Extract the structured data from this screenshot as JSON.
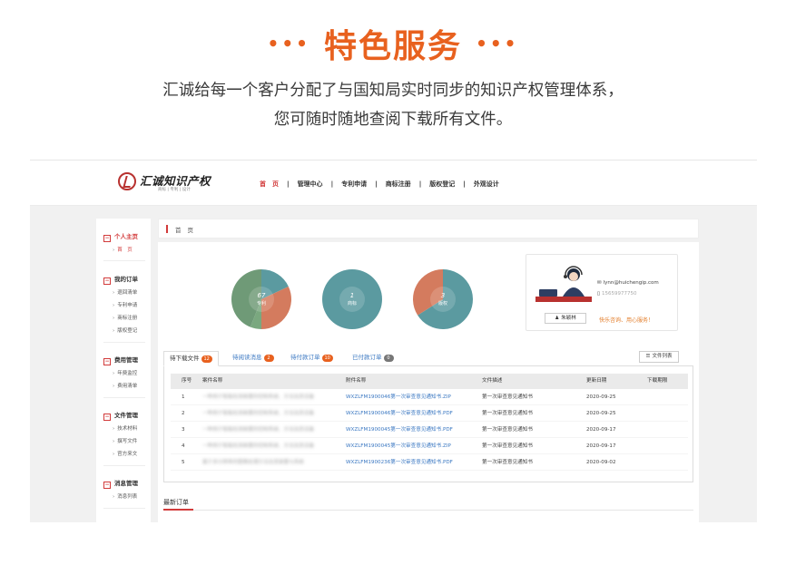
{
  "hero": {
    "dots_left": "•••",
    "title": "特色服务",
    "dots_right": "•••",
    "line1": "汇诚给每一个客户分配了与国知局实时同步的知识产权管理体系，",
    "line2": "您可随时随地查阅下载所有文件。"
  },
  "site": {
    "logo_name": "汇诚知识产权",
    "logo_tag": "商标 | 专利 | 设计",
    "nav": [
      "首　页",
      "管理中心",
      "专利申请",
      "商标注册",
      "版权登记",
      "外观设计"
    ]
  },
  "sidebar": [
    {
      "head": "个人主页",
      "items": [
        "首　页"
      ]
    },
    {
      "head": "我的订单",
      "items": [
        "退回清单",
        "专利申请",
        "商标注册",
        "版权登记"
      ]
    },
    {
      "head": "费用管理",
      "items": [
        "年费监控",
        "费用清单"
      ]
    },
    {
      "head": "文件管理",
      "items": [
        "技术材料",
        "撰写文件",
        "官方来文"
      ]
    },
    {
      "head": "消息管理",
      "items": [
        "消息列表"
      ]
    }
  ],
  "breadcrumb": "首页",
  "pies": [
    {
      "num": "67",
      "cap": "专利",
      "colors": [
        "#5b9aa0",
        "#d47b5e",
        "#7aa87f",
        "#6f9a77"
      ],
      "fractions": [
        0.18,
        0.32,
        0.06,
        0.44
      ]
    },
    {
      "num": "1",
      "cap": "商标",
      "colors": [
        "#5b9aa0"
      ],
      "fractions": [
        1
      ]
    },
    {
      "num": "3",
      "cap": "版权",
      "colors": [
        "#5b9aa0",
        "#d47b5e"
      ],
      "fractions": [
        0.66,
        0.34
      ]
    }
  ],
  "contact": {
    "email": "lynn@huichengip.com",
    "phone": "15659977750",
    "agent": "朱颖林",
    "slogan": "快乐咨询、用心服务！"
  },
  "tabs": [
    {
      "label": "待下载文件",
      "badge": "12",
      "badge_color": "#e8611f"
    },
    {
      "label": "待阅读消息",
      "badge": "2",
      "badge_color": "#e8611f"
    },
    {
      "label": "待付款订单",
      "badge": "10",
      "badge_color": "#e8611f"
    },
    {
      "label": "已付款订单",
      "badge": "0",
      "badge_color": "#777777"
    }
  ],
  "list_button": "文件列表",
  "table": {
    "headers": [
      "序号",
      "案件名称",
      "附件名称",
      "文件描述",
      "更新日期",
      "下载期限"
    ],
    "rows": [
      {
        "no": "1",
        "case": "一种用于智能检测装置的控制系统、方法及其设备",
        "file": "WXZLFM1900046第一次审查意见通知书.ZIP",
        "desc": "第一次审查意见通知书",
        "date": "2020-09-25"
      },
      {
        "no": "2",
        "case": "一种用于智能检测装置的控制系统、方法及其设备",
        "file": "WXZLFM1900046第一次审查意见通知书.PDF",
        "desc": "第一次审查意见通知书",
        "date": "2020-09-25"
      },
      {
        "no": "3",
        "case": "一种用于智能检测装置的控制系统、方法及其设备",
        "file": "WXZLFM1900045第一次审查意见通知书.PDF",
        "desc": "第一次审查意见通知书",
        "date": "2020-09-17"
      },
      {
        "no": "4",
        "case": "一种用于智能检测装置的控制系统、方法及其设备",
        "file": "WXZLFM1900045第一次审查意见通知书.ZIP",
        "desc": "第一次审查意见通知书",
        "date": "2020-09-17"
      },
      {
        "no": "5",
        "case": "基于多分辨率的图像处理方法及其装置与系统",
        "file": "WXZLFM1900236第一次审查意见通知书.PDF",
        "desc": "第一次审查意见通知书",
        "date": "2020-09-02"
      }
    ]
  },
  "latest_orders": "最新订单"
}
